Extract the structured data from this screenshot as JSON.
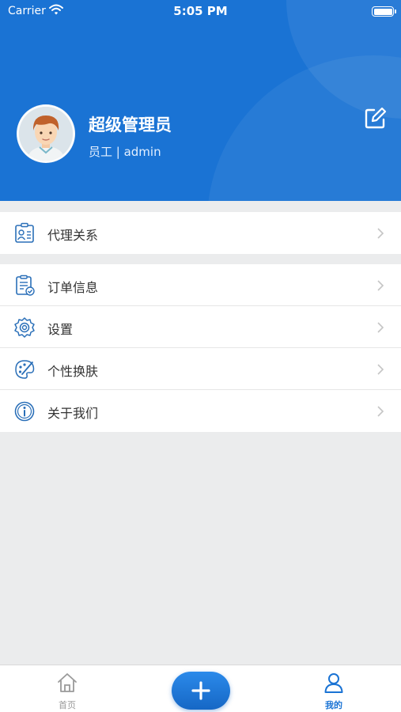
{
  "status_bar": {
    "carrier": "Carrier",
    "time": "5:05 PM"
  },
  "profile": {
    "name": "超级管理员",
    "role": "员工 | admin",
    "avatar_icon": "user-avatar-icon",
    "edit_icon": "edit-icon"
  },
  "menu_groups": [
    {
      "items": [
        {
          "label": "代理关系",
          "icon": "agent-relation-icon"
        }
      ]
    },
    {
      "items": [
        {
          "label": "订单信息",
          "icon": "order-info-icon"
        },
        {
          "label": "设置",
          "icon": "settings-icon"
        },
        {
          "label": "个性换肤",
          "icon": "theme-icon"
        },
        {
          "label": "关于我们",
          "icon": "info-icon"
        }
      ]
    }
  ],
  "tab_bar": {
    "home": {
      "label": "首页",
      "icon": "home-icon"
    },
    "add": {
      "icon": "plus-icon"
    },
    "mine": {
      "label": "我的",
      "icon": "user-icon"
    }
  },
  "colors": {
    "primary": "#1a73d4",
    "background": "#ebeced",
    "icon": "#2a6fb8",
    "text": "#333333",
    "tab_inactive": "#999999"
  }
}
